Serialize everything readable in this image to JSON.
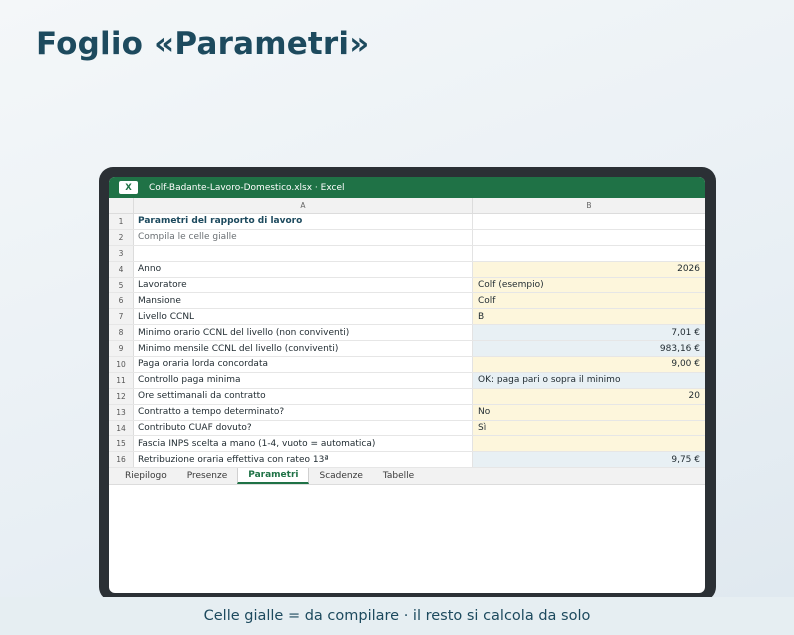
{
  "page": {
    "title": "Foglio «Parametri»",
    "footer": "Celle gialle = da compilare · il resto si calcola da solo"
  },
  "window": {
    "app_icon": "X",
    "title": "Colf-Badante-Lavoro-Domestico.xlsx · Excel",
    "accent_color": "#1f7246"
  },
  "sheet": {
    "columns": [
      "A",
      "B"
    ],
    "rows": [
      {
        "n": "1",
        "a": "Parametri del rapporto di lavoro",
        "b": ""
      },
      {
        "n": "2",
        "a": "Compila le celle gialle",
        "b": ""
      },
      {
        "n": "3",
        "a": "",
        "b": ""
      },
      {
        "n": "4",
        "a": "Anno",
        "b": "2026"
      },
      {
        "n": "5",
        "a": "Lavoratore",
        "b": "Colf (esempio)"
      },
      {
        "n": "6",
        "a": "Mansione",
        "b": "Colf"
      },
      {
        "n": "7",
        "a": "Livello CCNL",
        "b": "B"
      },
      {
        "n": "8",
        "a": "Minimo orario CCNL del livello (non conviventi)",
        "b": "7,01 €"
      },
      {
        "n": "9",
        "a": "Minimo mensile CCNL del livello (conviventi)",
        "b": "983,16 €"
      },
      {
        "n": "10",
        "a": "Paga oraria lorda concordata",
        "b": "9,00 €"
      },
      {
        "n": "11",
        "a": "Controllo paga minima",
        "b": "OK: paga pari o sopra il minimo"
      },
      {
        "n": "12",
        "a": "Ore settimanali da contratto",
        "b": "20"
      },
      {
        "n": "13",
        "a": "Contratto a tempo determinato?",
        "b": "No"
      },
      {
        "n": "14",
        "a": "Contributo CUAF dovuto?",
        "b": "Sì"
      },
      {
        "n": "15",
        "a": "Fascia INPS scelta a mano (1-4, vuoto = automatica)",
        "b": ""
      },
      {
        "n": "16",
        "a": "Retribuzione oraria effettiva con rateo 13ª",
        "b": "9,75 €"
      }
    ],
    "input_cell_color": "#fdf6dc",
    "calculated_cell_color": "#e8f0f4"
  },
  "tabs": [
    "Riepilogo",
    "Presenze",
    "Parametri",
    "Scadenze",
    "Tabelle"
  ],
  "active_tab": "Parametri"
}
